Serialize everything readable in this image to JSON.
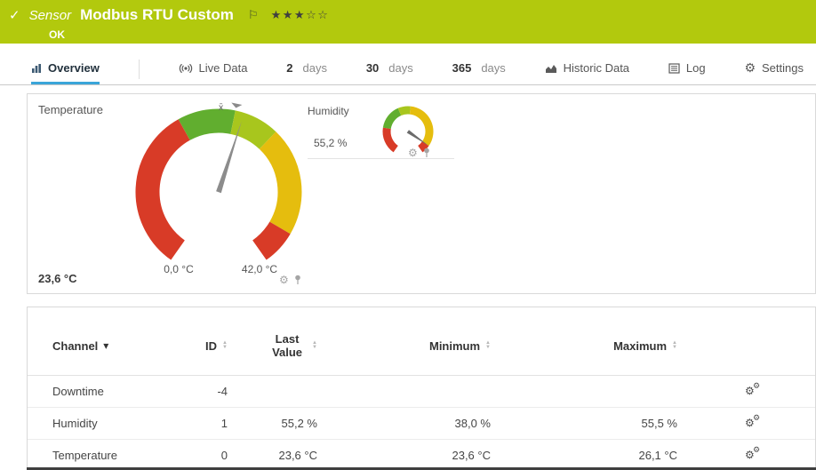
{
  "colors": {
    "header_bg": "#b2c90d",
    "active_tab_underline": "#3aa5d9",
    "bottom_bar": "#3f3f3f"
  },
  "icons": {
    "check": "✓",
    "flag": "⚐",
    "stars_filled": "★★★",
    "stars_empty": "☆☆",
    "gear": "⚙",
    "sort_up": "▲",
    "sort_down": "▼",
    "dropdown_arrow": "▾",
    "mean_marker": "x̄"
  },
  "header": {
    "type_label": "Sensor",
    "title": "Modbus RTU Custom",
    "status": "OK"
  },
  "tabs": {
    "overview": "Overview",
    "live_data": "Live Data",
    "days2_num": "2",
    "days2_unit": "days",
    "days30_num": "30",
    "days30_unit": "days",
    "days365_num": "365",
    "days365_unit": "days",
    "historic": "Historic Data",
    "log": "Log",
    "settings": "Settings"
  },
  "gauges": {
    "temperature": {
      "label": "Temperature",
      "value_display": "23,6 °C",
      "value": 23.6,
      "min": 0,
      "max": 42,
      "min_label": "0,0 °C",
      "max_label": "42,0 °C",
      "needle_color": "#8c8c8c",
      "mean_fraction": 0.54,
      "segments": [
        {
          "from": 0,
          "to": 0.4,
          "color": "#d83b27"
        },
        {
          "from": 0.4,
          "to": 0.54,
          "color": "#61ae2f"
        },
        {
          "from": 0.54,
          "to": 0.65,
          "color": "#a8c61d"
        },
        {
          "from": 0.65,
          "to": 0.915,
          "color": "#e5bd0e"
        },
        {
          "from": 0.915,
          "to": 1,
          "color": "#d83b27"
        }
      ]
    },
    "humidity": {
      "label": "Humidity",
      "value_display": "55,2 %",
      "value": 55.2,
      "needle_color": "#6b6b6b",
      "segments": [
        {
          "from": 0,
          "to": 0.22,
          "color": "#d83b27"
        },
        {
          "from": 0.22,
          "to": 0.42,
          "color": "#61ae2f"
        },
        {
          "from": 0.42,
          "to": 0.52,
          "color": "#a8c61d"
        },
        {
          "from": 0.52,
          "to": 0.93,
          "color": "#e5bd0e"
        },
        {
          "from": 0.93,
          "to": 1,
          "color": "#d83b27"
        }
      ]
    }
  },
  "table": {
    "columns": [
      {
        "label": "Channel"
      },
      {
        "label": "ID"
      },
      {
        "label": "Last Value"
      },
      {
        "label": "Minimum"
      },
      {
        "label": "Maximum"
      }
    ],
    "rows": [
      {
        "channel": "Downtime",
        "id": "-4",
        "last_value": "",
        "minimum": "",
        "maximum": ""
      },
      {
        "channel": "Humidity",
        "id": "1",
        "last_value": "55,2 %",
        "minimum": "38,0 %",
        "maximum": "55,5 %"
      },
      {
        "channel": "Temperature",
        "id": "0",
        "last_value": "23,6 °C",
        "minimum": "23,6 °C",
        "maximum": "26,1 °C"
      }
    ]
  }
}
